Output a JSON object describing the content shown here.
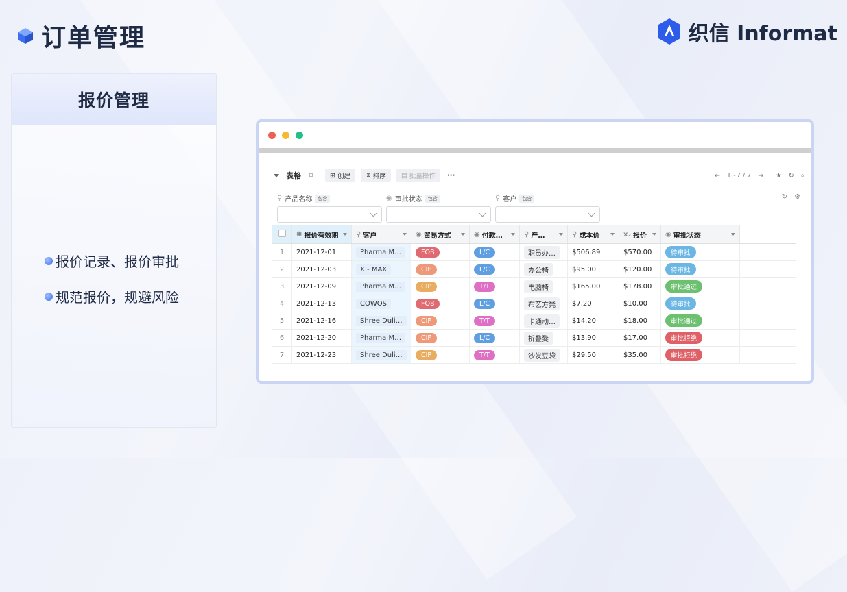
{
  "header": {
    "title": "订单管理",
    "brand_name": "织信 Informat"
  },
  "card": {
    "title": "报价管理",
    "bullets": [
      "报价记录、报价审批",
      "规范报价，规避风险"
    ]
  },
  "app": {
    "view_name": "表格",
    "buttons": {
      "create": "创建",
      "sort": "排序",
      "batch": "批量操作",
      "more": "···"
    },
    "pagination": "1~7 / 7",
    "filters": [
      {
        "label": "产品名称",
        "mode": "包含"
      },
      {
        "label": "审批状态",
        "mode": "包含"
      },
      {
        "label": "客户",
        "mode": "包含"
      }
    ],
    "columns": [
      "报价有效期",
      "客户",
      "贸易方式",
      "付款…",
      "产…",
      "成本价",
      "报价",
      "审批状态"
    ],
    "rows": [
      {
        "idx": "1",
        "date": "2021-12-01",
        "customer": "Pharma M…",
        "trade": "FOB",
        "payment": "L/C",
        "product": "职员办…",
        "cost": "$506.89",
        "price": "$570.00",
        "status": "待审批"
      },
      {
        "idx": "2",
        "date": "2021-12-03",
        "customer": "X - MAX",
        "trade": "CIF",
        "payment": "L/C",
        "product": "办公椅",
        "cost": "$95.00",
        "price": "$120.00",
        "status": "待审批"
      },
      {
        "idx": "3",
        "date": "2021-12-09",
        "customer": "Pharma M…",
        "trade": "CIP",
        "payment": "T/T",
        "product": "电脑椅",
        "cost": "$165.00",
        "price": "$178.00",
        "status": "审批通过"
      },
      {
        "idx": "4",
        "date": "2021-12-13",
        "customer": "COWOS",
        "trade": "FOB",
        "payment": "L/C",
        "product": "布艺方凳",
        "cost": "$7.20",
        "price": "$10.00",
        "status": "待审批"
      },
      {
        "idx": "5",
        "date": "2021-12-16",
        "customer": "Shree Duli…",
        "trade": "CIF",
        "payment": "T/T",
        "product": "卡通动…",
        "cost": "$14.20",
        "price": "$18.00",
        "status": "审批通过"
      },
      {
        "idx": "6",
        "date": "2021-12-20",
        "customer": "Pharma M…",
        "trade": "CIF",
        "payment": "L/C",
        "product": "折叠凳",
        "cost": "$13.90",
        "price": "$17.00",
        "status": "审批拒绝"
      },
      {
        "idx": "7",
        "date": "2021-12-23",
        "customer": "Shree Duli…",
        "trade": "CIP",
        "payment": "T/T",
        "product": "沙发豆袋",
        "cost": "$29.50",
        "price": "$35.00",
        "status": "审批拒绝"
      }
    ]
  },
  "colors": {
    "FOB": "#e06a72",
    "CIF": "#ee9a7a",
    "CIP": "#e9ad62",
    "L/C": "#5f9ee0",
    "T/T": "#de6fc4",
    "待审批": "#6bb6e4",
    "审批通过": "#6cc070",
    "审批拒绝": "#df6167"
  }
}
